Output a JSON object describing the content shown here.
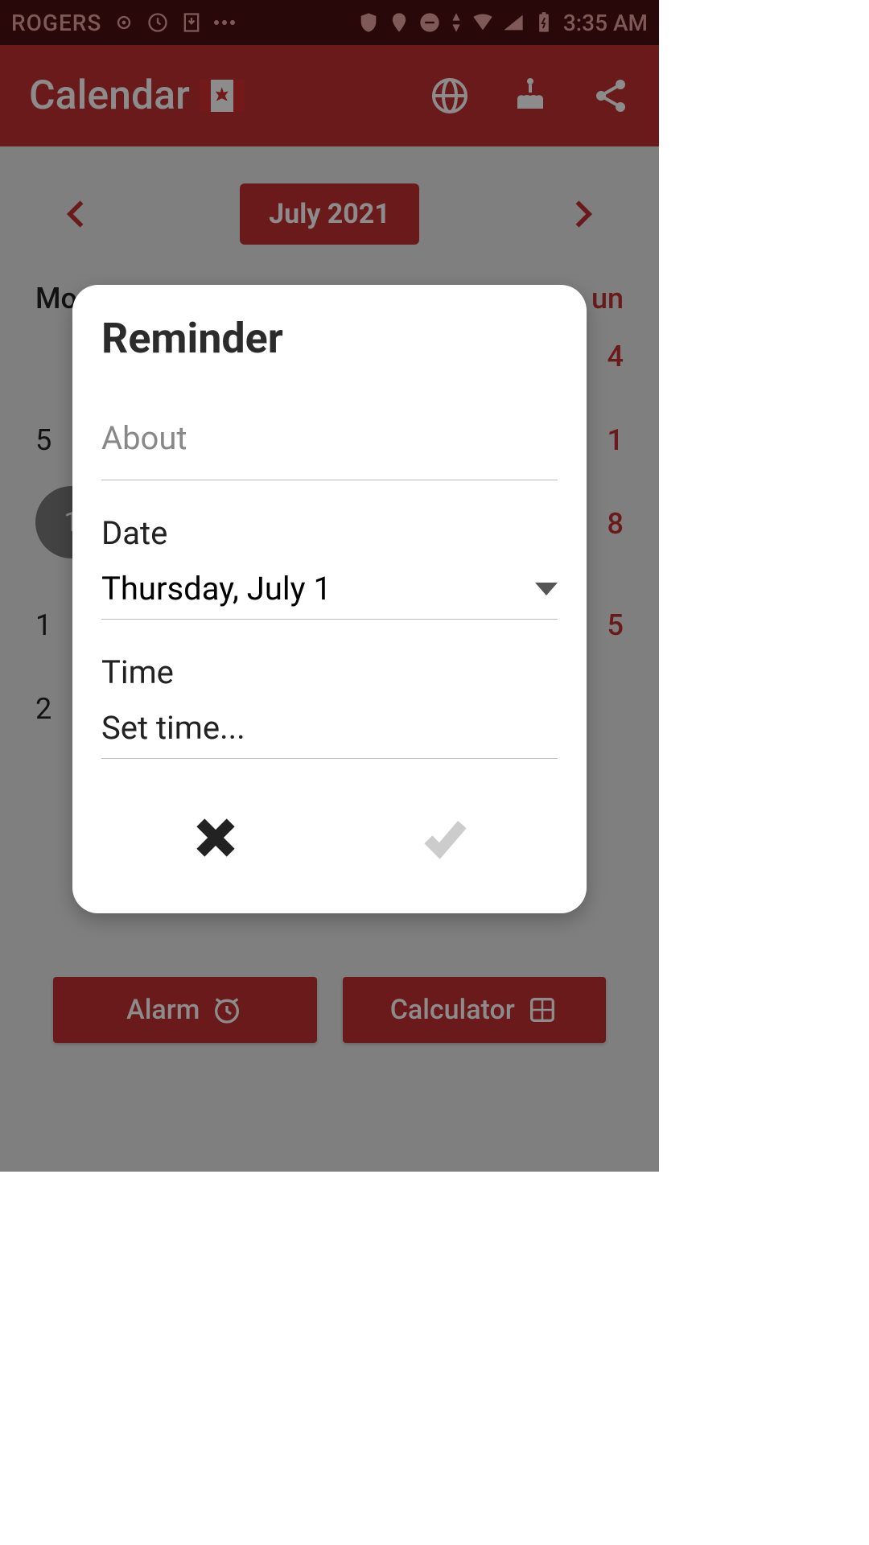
{
  "status": {
    "carrier": "ROGERS",
    "time": "3:35 AM"
  },
  "header": {
    "title": "Calendar"
  },
  "month_nav": {
    "label": "July 2021"
  },
  "calendar": {
    "day_left": "Mo",
    "day_right_suffix": "un",
    "col7_r1": "4",
    "col1_r2": "5",
    "col7_r2": "1",
    "col1_r3": "1",
    "col7_r3": "8",
    "col1_r4": "1",
    "col7_r4": "5",
    "col1_r5": "2"
  },
  "buttons": {
    "alarm": "Alarm",
    "calculator": "Calculator"
  },
  "dialog": {
    "title": "Reminder",
    "about_placeholder": "About",
    "date_label": "Date",
    "date_value": "Thursday, July 1",
    "time_label": "Time",
    "time_value": "Set time..."
  }
}
